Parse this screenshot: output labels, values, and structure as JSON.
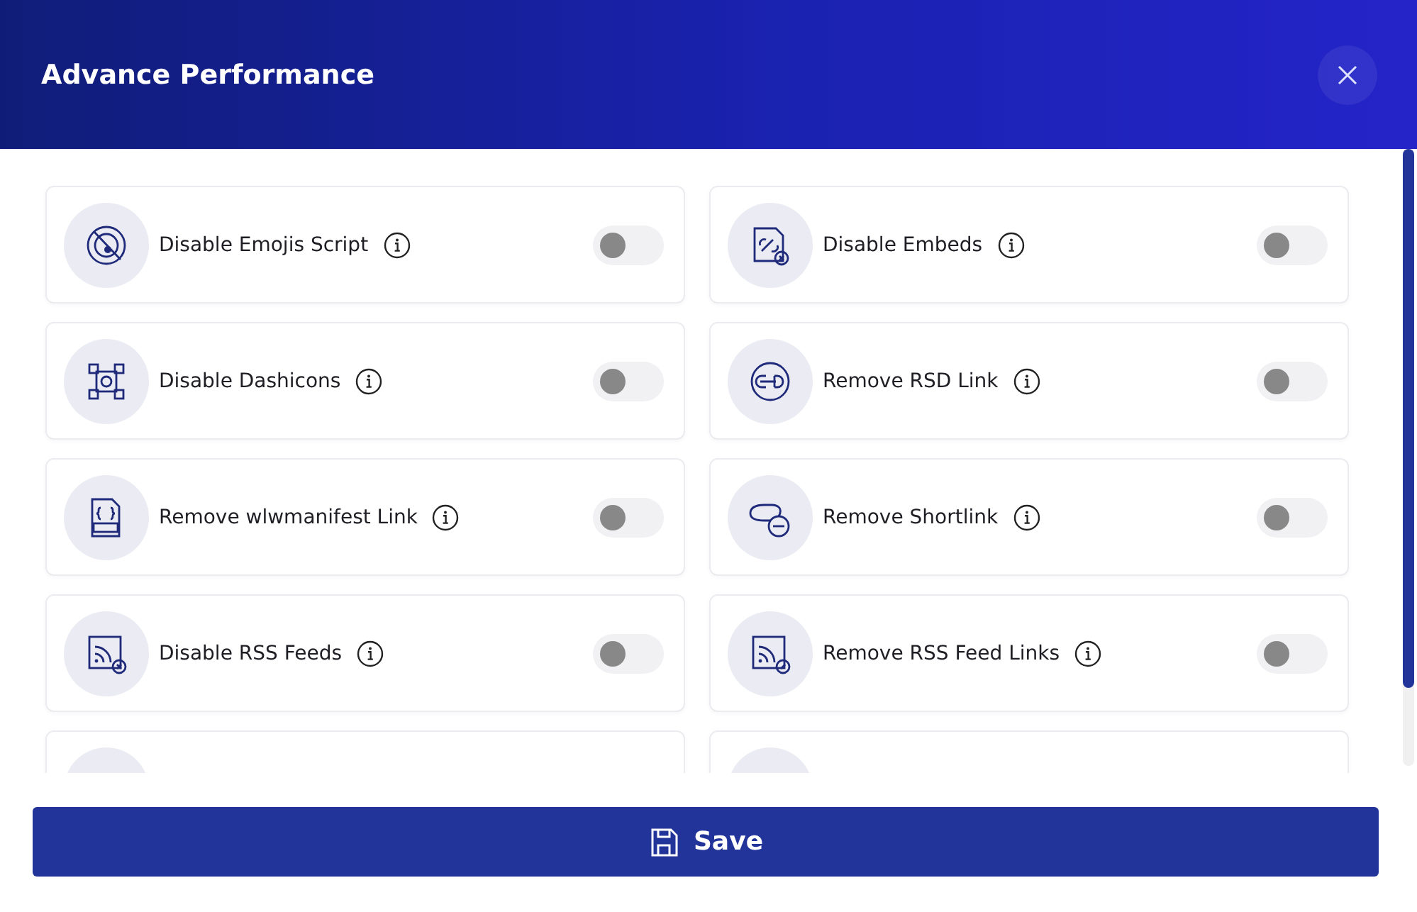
{
  "window": {
    "title": "Advance Performance"
  },
  "options": [
    {
      "kind": "emoji",
      "label": "Disable Emojis Script",
      "on": false
    },
    {
      "kind": "embed",
      "label": "Disable Embeds",
      "on": false
    },
    {
      "kind": "dashicons",
      "label": "Disable Dashicons",
      "on": false
    },
    {
      "kind": "rsd",
      "label": "Remove RSD Link",
      "on": false
    },
    {
      "kind": "manifest",
      "label": "Remove wlwmanifest Link",
      "on": false
    },
    {
      "kind": "shortlink",
      "label": "Remove Shortlink",
      "on": false
    },
    {
      "kind": "rss",
      "label": "Disable RSS Feeds",
      "on": false
    },
    {
      "kind": "rsslink",
      "label": "Remove RSS Feed Links",
      "on": false
    }
  ],
  "save_button": {
    "label": "Save"
  }
}
